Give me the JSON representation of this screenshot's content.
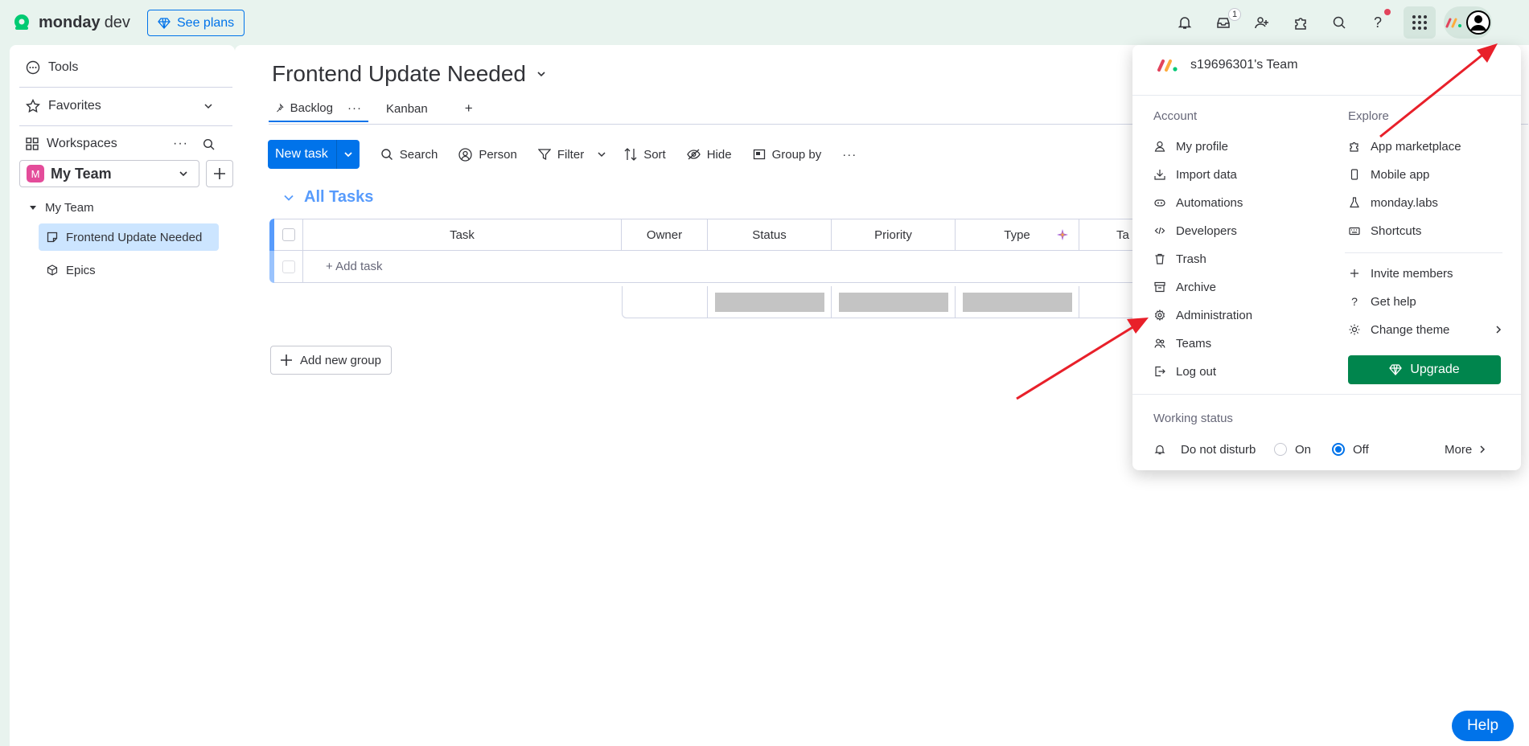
{
  "topbar": {
    "brand": "monday",
    "brand_suffix": "dev",
    "see_plans": "See plans",
    "inbox_badge": "1"
  },
  "sidebar": {
    "tools": "Tools",
    "favorites": "Favorites",
    "workspaces": "Workspaces",
    "workspace_name": "My Team",
    "workspace_initial": "M",
    "tree_root": "My Team",
    "items": [
      {
        "label": "Frontend Update Needed"
      },
      {
        "label": "Epics"
      }
    ]
  },
  "board": {
    "title": "Frontend Update Needed",
    "views": [
      {
        "label": "Backlog"
      },
      {
        "label": "Kanban"
      }
    ],
    "add_view": "+",
    "toolbar": {
      "new_task": "New task",
      "search": "Search",
      "person": "Person",
      "filter": "Filter",
      "sort": "Sort",
      "hide": "Hide",
      "group_by": "Group by"
    },
    "group_title": "All Tasks",
    "columns": [
      "Task",
      "Owner",
      "Status",
      "Priority",
      "Type",
      "Ta"
    ],
    "add_task": "+ Add task",
    "add_group": "Add new group"
  },
  "menu": {
    "team": "s19696301's Team",
    "account_label": "Account",
    "explore_label": "Explore",
    "account": [
      {
        "label": "My profile",
        "icon": "person-icon"
      },
      {
        "label": "Import data",
        "icon": "download-icon"
      },
      {
        "label": "Automations",
        "icon": "robot-icon"
      },
      {
        "label": "Developers",
        "icon": "code-icon"
      },
      {
        "label": "Trash",
        "icon": "trash-icon"
      },
      {
        "label": "Archive",
        "icon": "archive-icon"
      },
      {
        "label": "Administration",
        "icon": "gear-icon"
      },
      {
        "label": "Teams",
        "icon": "team-icon"
      },
      {
        "label": "Log out",
        "icon": "logout-icon"
      }
    ],
    "explore": [
      {
        "label": "App marketplace",
        "icon": "puzzle-icon"
      },
      {
        "label": "Mobile app",
        "icon": "mobile-icon"
      },
      {
        "label": "monday.labs",
        "icon": "flask-icon"
      },
      {
        "label": "Shortcuts",
        "icon": "keyboard-icon"
      }
    ],
    "explore2": [
      {
        "label": "Invite members",
        "icon": "plus-icon"
      },
      {
        "label": "Get help",
        "icon": "question-icon"
      },
      {
        "label": "Change theme",
        "icon": "sun-icon"
      }
    ],
    "upgrade": "Upgrade",
    "working_status_label": "Working status",
    "do_not_disturb": "Do not disturb",
    "on": "On",
    "off": "Off",
    "off_selected": true,
    "more": "More"
  },
  "help": "Help",
  "colors": {
    "accent": "#0073ea",
    "group": "#579bfc",
    "upgrade": "#00854d",
    "annotation": "#e8202a"
  }
}
